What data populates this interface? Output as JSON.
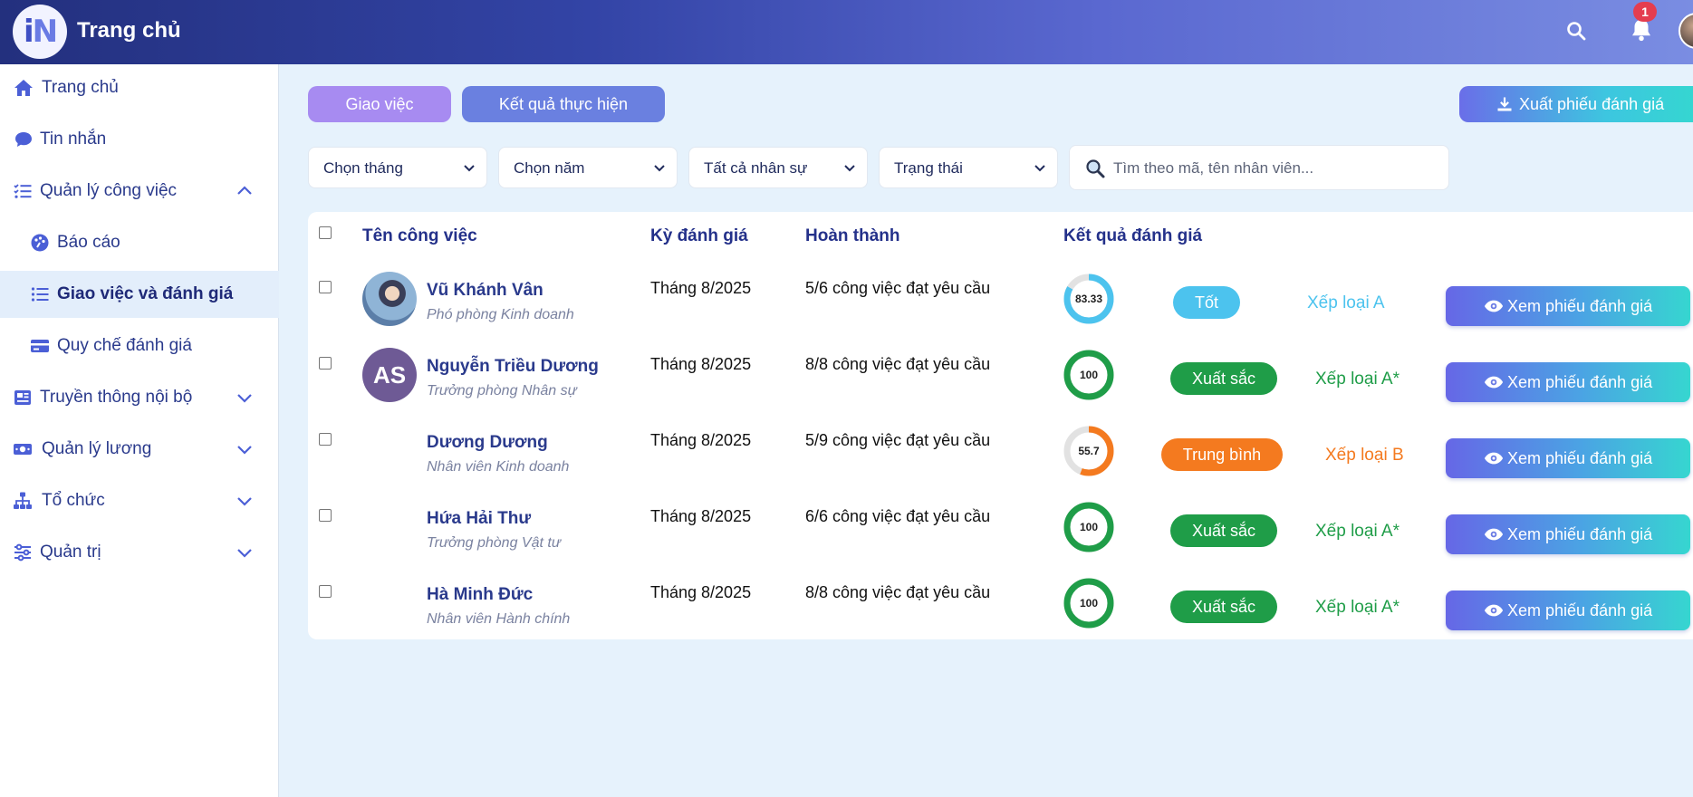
{
  "header": {
    "app_title": "Trang chủ",
    "notification_count": "1",
    "accent_gradient": [
      "#23307e",
      "#7a8de2"
    ]
  },
  "sidebar": {
    "items": [
      {
        "label": "Trang chủ",
        "icon": "home-icon"
      },
      {
        "label": "Tin nhắn",
        "icon": "chat-icon"
      },
      {
        "label": "Quản lý công việc",
        "icon": "task-list-icon",
        "expanded": true
      },
      {
        "label": "Báo cáo",
        "icon": "palette-icon"
      },
      {
        "label": "Giao việc và đánh giá",
        "icon": "list-icon",
        "active": true
      },
      {
        "label": "Quy chế đánh giá",
        "icon": "card-icon"
      },
      {
        "label": "Truyền thông nội bộ",
        "icon": "news-icon"
      },
      {
        "label": "Quản lý lương",
        "icon": "money-icon"
      },
      {
        "label": "Tổ chức",
        "icon": "org-icon"
      },
      {
        "label": "Quản trị",
        "icon": "sliders-icon"
      }
    ]
  },
  "toolbar": {
    "assign_label": "Giao việc",
    "results_label": "Kết quả thực hiện",
    "export_label": "Xuất phiếu đánh giá"
  },
  "filters": {
    "month": "Chọn tháng",
    "year": "Chọn năm",
    "staff": "Tất cả nhân sự",
    "status": "Trạng thái",
    "search_placeholder": "Tìm theo mã, tên nhân viên..."
  },
  "table": {
    "headers": {
      "task_name": "Tên công việc",
      "period": "Kỳ đánh giá",
      "completion": "Hoàn thành",
      "result": "Kết quả đánh giá"
    },
    "view_label": "Xem phiếu đánh giá",
    "rows": [
      {
        "name": "Vũ Khánh Vân",
        "role": "Phó phòng Kinh doanh",
        "avatar": "photo",
        "initials": "",
        "period": "Tháng 8/2025",
        "completion": "5/6 công việc đạt yêu cầu",
        "score": "83.33",
        "score_value": 83.33,
        "level": "Tốt",
        "grade": "Xếp loại A",
        "color": "#4cc3ee",
        "grade_color": "#4cc3ee"
      },
      {
        "name": "Nguyễn Triều Dương",
        "role": "Trưởng phòng Nhân sự",
        "avatar": "initials",
        "initials": "AS",
        "period": "Tháng 8/2025",
        "completion": "8/8 công việc đạt yêu cầu",
        "score": "100",
        "score_value": 100,
        "level": "Xuất sắc",
        "grade": "Xếp loại A*",
        "color": "#1f9d48",
        "grade_color": "#1f9d48"
      },
      {
        "name": "Dương Dương",
        "role": "Nhân viên Kinh doanh",
        "avatar": "none",
        "initials": "",
        "period": "Tháng 8/2025",
        "completion": "5/9 công việc đạt yêu cầu",
        "score": "55.7",
        "score_value": 55.7,
        "level": "Trung bình",
        "grade": "Xếp loại B",
        "color": "#f47a1f",
        "grade_color": "#f47a1f"
      },
      {
        "name": "Hứa Hải Thư",
        "role": "Trưởng phòng Vật tư",
        "avatar": "none",
        "initials": "",
        "period": "Tháng 8/2025",
        "completion": "6/6 công việc đạt yêu cầu",
        "score": "100",
        "score_value": 100,
        "level": "Xuất sắc",
        "grade": "Xếp loại A*",
        "color": "#1f9d48",
        "grade_color": "#1f9d48"
      },
      {
        "name": "Hà Minh Đức",
        "role": "Nhân viên Hành chính",
        "avatar": "none",
        "initials": "",
        "period": "Tháng 8/2025",
        "completion": "8/8 công việc đạt yêu cầu",
        "score": "100",
        "score_value": 100,
        "level": "Xuất sắc",
        "grade": "Xếp loại A*",
        "color": "#1f9d48",
        "grade_color": "#1f9d48"
      }
    ]
  }
}
